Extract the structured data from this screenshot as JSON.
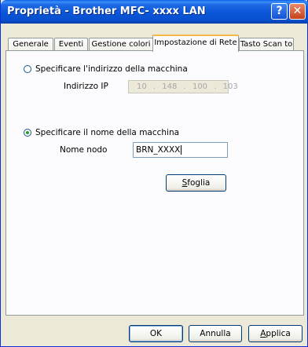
{
  "window": {
    "title": "Proprietà - Brother MFC- xxxx LAN",
    "help_glyph": "?",
    "close_glyph": "✕"
  },
  "tabs": [
    {
      "label": "Generale"
    },
    {
      "label": "Eventi"
    },
    {
      "label": "Gestione colori"
    },
    {
      "label": "Impostazione di Rete"
    },
    {
      "label": "Tasto Scan to"
    }
  ],
  "active_tab": "Impostazione di Rete",
  "network": {
    "option_address": {
      "label": "Specificare l'indirizzo della macchina",
      "selected": false
    },
    "ip_label": "Indirizzo IP",
    "ip_octets": [
      "10",
      "148",
      "100",
      "103"
    ],
    "ip_sep": ".",
    "option_name": {
      "label": "Specificare il nome della macchina",
      "selected": true
    },
    "node_label": "Nome nodo",
    "node_value": "BRN_XXXX",
    "browse_label_first": "S",
    "browse_label_rest": "foglia"
  },
  "footer": {
    "ok": "OK",
    "cancel": "Annulla",
    "apply_first": "A",
    "apply_rest": "pplica"
  },
  "colors": {
    "titlebar": "#0a55d8",
    "tab_highlight": "#f5b844",
    "face": "#ece9d8"
  }
}
